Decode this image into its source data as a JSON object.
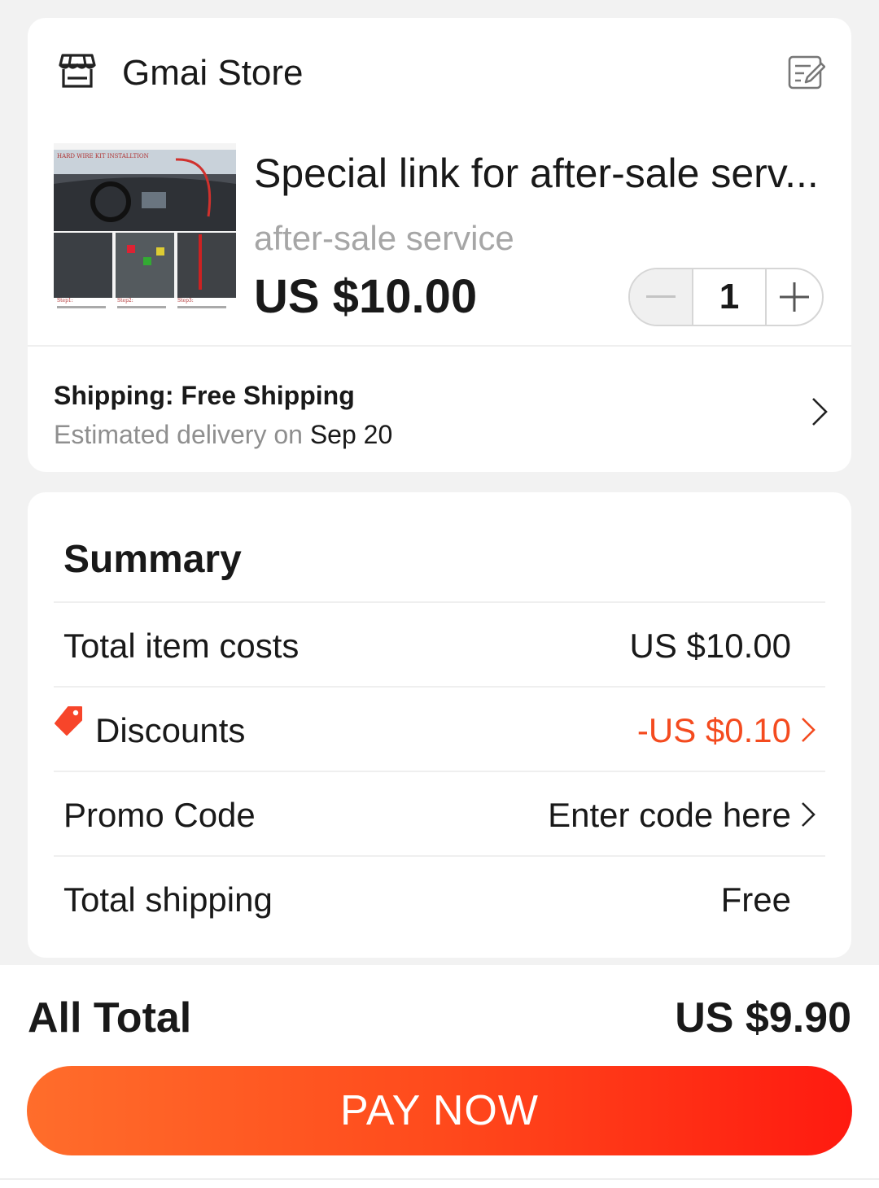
{
  "store": {
    "name": "Gmai Store",
    "icon": "store-icon",
    "edit_icon": "edit-note-icon"
  },
  "product": {
    "title": "Special link for after-sale serv...",
    "variant": "after-sale service",
    "price": "US $10.00",
    "quantity": "1",
    "image_caption": "HARD WIRE KIT INSTALLTION",
    "image_steps": [
      "Step1:",
      "Step2:",
      "Step3:"
    ]
  },
  "shipping": {
    "title": "Shipping: Free Shipping",
    "delivery_prefix": "Estimated delivery on",
    "delivery_date": "Sep 20"
  },
  "summary": {
    "title": "Summary",
    "rows": [
      {
        "label": "Total item costs",
        "value": "US $10.00"
      },
      {
        "label": "Discounts",
        "value": "-US $0.10"
      },
      {
        "label": "Promo Code",
        "value": "Enter code here"
      },
      {
        "label": "Total shipping",
        "value": "Free"
      }
    ]
  },
  "footer": {
    "all_total_label": "All Total",
    "all_total_value": "US $9.90",
    "pay_button": "PAY NOW"
  },
  "colors": {
    "accent": "#ff4a1c",
    "discount_red": "#f44b1f",
    "tag_red": "#f7452a"
  }
}
